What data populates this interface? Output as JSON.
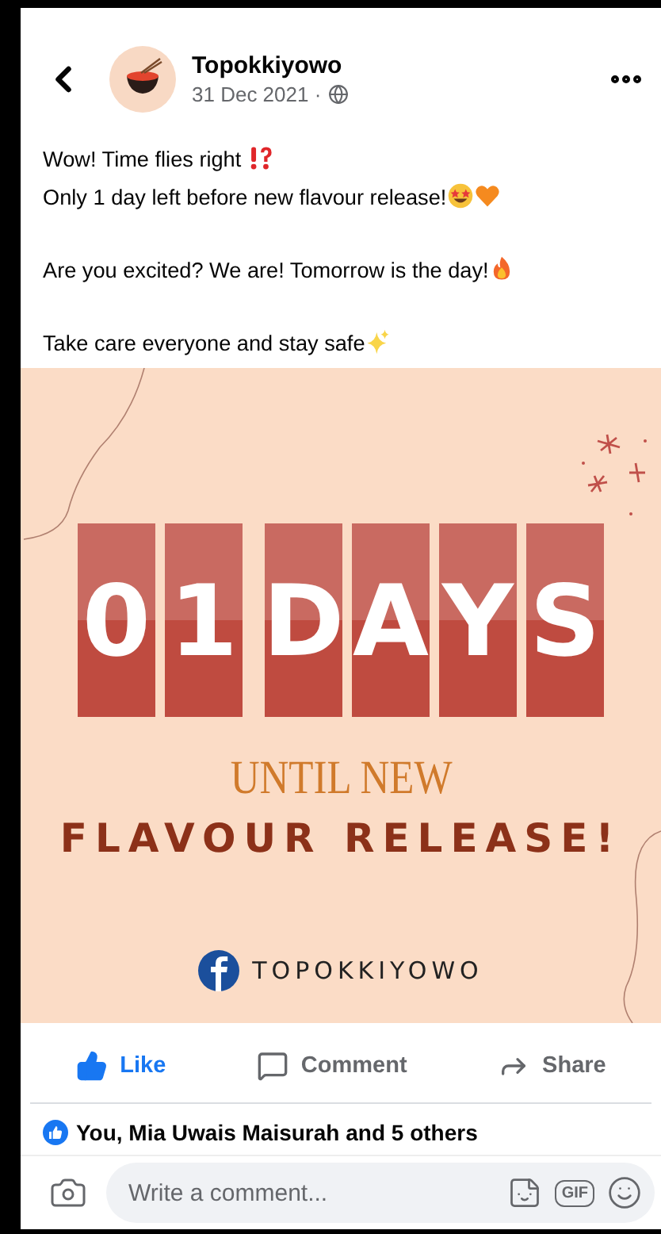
{
  "header": {
    "page_name": "Topokkiyowo",
    "date": "31 Dec 2021 ·"
  },
  "paragraphs": [
    [
      {
        "kind": "text",
        "text": "Wow! Time flies right "
      },
      {
        "kind": "interrobang"
      },
      {
        "kind": "text",
        "text": "Only 1 day left before new"
      },
      {
        "kind": "text",
        "text": " flavour release!"
      },
      {
        "kind": "starstruck"
      },
      {
        "kind": "heart"
      }
    ],
    [
      {
        "kind": "text",
        "text": "Are you excited? We are! Tomorrow is the day!"
      },
      {
        "kind": "fire"
      }
    ],
    [
      {
        "kind": "text",
        "text": "Take care everyone and stay safe"
      },
      {
        "kind": "sparkles"
      }
    ]
  ],
  "graphic": {
    "tile_groups": [
      [
        "0",
        "1"
      ],
      [
        "D",
        "A",
        "Y",
        "S"
      ]
    ],
    "subtitle": "UNTIL NEW",
    "headline": "FLAVOUR RELEASE!",
    "handle": "TOPOKKIYOWO"
  },
  "actions": [
    {
      "kind": "like",
      "label": "Like",
      "active": true
    },
    {
      "kind": "comment",
      "label": "Comment",
      "active": false
    },
    {
      "kind": "share",
      "label": "Share",
      "active": false
    }
  ],
  "reactions": "You, Mia Uwais Maisurah and 5 others",
  "comment_bar": {
    "placeholder": "Write a comment...",
    "gif": "GIF"
  }
}
